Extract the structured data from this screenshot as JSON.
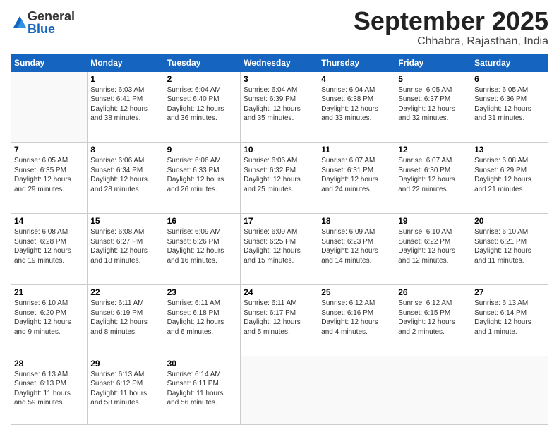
{
  "logo": {
    "general": "General",
    "blue": "Blue"
  },
  "title": "September 2025",
  "location": "Chhabra, Rajasthan, India",
  "days_of_week": [
    "Sunday",
    "Monday",
    "Tuesday",
    "Wednesday",
    "Thursday",
    "Friday",
    "Saturday"
  ],
  "weeks": [
    [
      {
        "num": "",
        "info": ""
      },
      {
        "num": "1",
        "info": "Sunrise: 6:03 AM\nSunset: 6:41 PM\nDaylight: 12 hours\nand 38 minutes."
      },
      {
        "num": "2",
        "info": "Sunrise: 6:04 AM\nSunset: 6:40 PM\nDaylight: 12 hours\nand 36 minutes."
      },
      {
        "num": "3",
        "info": "Sunrise: 6:04 AM\nSunset: 6:39 PM\nDaylight: 12 hours\nand 35 minutes."
      },
      {
        "num": "4",
        "info": "Sunrise: 6:04 AM\nSunset: 6:38 PM\nDaylight: 12 hours\nand 33 minutes."
      },
      {
        "num": "5",
        "info": "Sunrise: 6:05 AM\nSunset: 6:37 PM\nDaylight: 12 hours\nand 32 minutes."
      },
      {
        "num": "6",
        "info": "Sunrise: 6:05 AM\nSunset: 6:36 PM\nDaylight: 12 hours\nand 31 minutes."
      }
    ],
    [
      {
        "num": "7",
        "info": "Sunrise: 6:05 AM\nSunset: 6:35 PM\nDaylight: 12 hours\nand 29 minutes."
      },
      {
        "num": "8",
        "info": "Sunrise: 6:06 AM\nSunset: 6:34 PM\nDaylight: 12 hours\nand 28 minutes."
      },
      {
        "num": "9",
        "info": "Sunrise: 6:06 AM\nSunset: 6:33 PM\nDaylight: 12 hours\nand 26 minutes."
      },
      {
        "num": "10",
        "info": "Sunrise: 6:06 AM\nSunset: 6:32 PM\nDaylight: 12 hours\nand 25 minutes."
      },
      {
        "num": "11",
        "info": "Sunrise: 6:07 AM\nSunset: 6:31 PM\nDaylight: 12 hours\nand 24 minutes."
      },
      {
        "num": "12",
        "info": "Sunrise: 6:07 AM\nSunset: 6:30 PM\nDaylight: 12 hours\nand 22 minutes."
      },
      {
        "num": "13",
        "info": "Sunrise: 6:08 AM\nSunset: 6:29 PM\nDaylight: 12 hours\nand 21 minutes."
      }
    ],
    [
      {
        "num": "14",
        "info": "Sunrise: 6:08 AM\nSunset: 6:28 PM\nDaylight: 12 hours\nand 19 minutes."
      },
      {
        "num": "15",
        "info": "Sunrise: 6:08 AM\nSunset: 6:27 PM\nDaylight: 12 hours\nand 18 minutes."
      },
      {
        "num": "16",
        "info": "Sunrise: 6:09 AM\nSunset: 6:26 PM\nDaylight: 12 hours\nand 16 minutes."
      },
      {
        "num": "17",
        "info": "Sunrise: 6:09 AM\nSunset: 6:25 PM\nDaylight: 12 hours\nand 15 minutes."
      },
      {
        "num": "18",
        "info": "Sunrise: 6:09 AM\nSunset: 6:23 PM\nDaylight: 12 hours\nand 14 minutes."
      },
      {
        "num": "19",
        "info": "Sunrise: 6:10 AM\nSunset: 6:22 PM\nDaylight: 12 hours\nand 12 minutes."
      },
      {
        "num": "20",
        "info": "Sunrise: 6:10 AM\nSunset: 6:21 PM\nDaylight: 12 hours\nand 11 minutes."
      }
    ],
    [
      {
        "num": "21",
        "info": "Sunrise: 6:10 AM\nSunset: 6:20 PM\nDaylight: 12 hours\nand 9 minutes."
      },
      {
        "num": "22",
        "info": "Sunrise: 6:11 AM\nSunset: 6:19 PM\nDaylight: 12 hours\nand 8 minutes."
      },
      {
        "num": "23",
        "info": "Sunrise: 6:11 AM\nSunset: 6:18 PM\nDaylight: 12 hours\nand 6 minutes."
      },
      {
        "num": "24",
        "info": "Sunrise: 6:11 AM\nSunset: 6:17 PM\nDaylight: 12 hours\nand 5 minutes."
      },
      {
        "num": "25",
        "info": "Sunrise: 6:12 AM\nSunset: 6:16 PM\nDaylight: 12 hours\nand 4 minutes."
      },
      {
        "num": "26",
        "info": "Sunrise: 6:12 AM\nSunset: 6:15 PM\nDaylight: 12 hours\nand 2 minutes."
      },
      {
        "num": "27",
        "info": "Sunrise: 6:13 AM\nSunset: 6:14 PM\nDaylight: 12 hours\nand 1 minute."
      }
    ],
    [
      {
        "num": "28",
        "info": "Sunrise: 6:13 AM\nSunset: 6:13 PM\nDaylight: 11 hours\nand 59 minutes."
      },
      {
        "num": "29",
        "info": "Sunrise: 6:13 AM\nSunset: 6:12 PM\nDaylight: 11 hours\nand 58 minutes."
      },
      {
        "num": "30",
        "info": "Sunrise: 6:14 AM\nSunset: 6:11 PM\nDaylight: 11 hours\nand 56 minutes."
      },
      {
        "num": "",
        "info": ""
      },
      {
        "num": "",
        "info": ""
      },
      {
        "num": "",
        "info": ""
      },
      {
        "num": "",
        "info": ""
      }
    ]
  ]
}
